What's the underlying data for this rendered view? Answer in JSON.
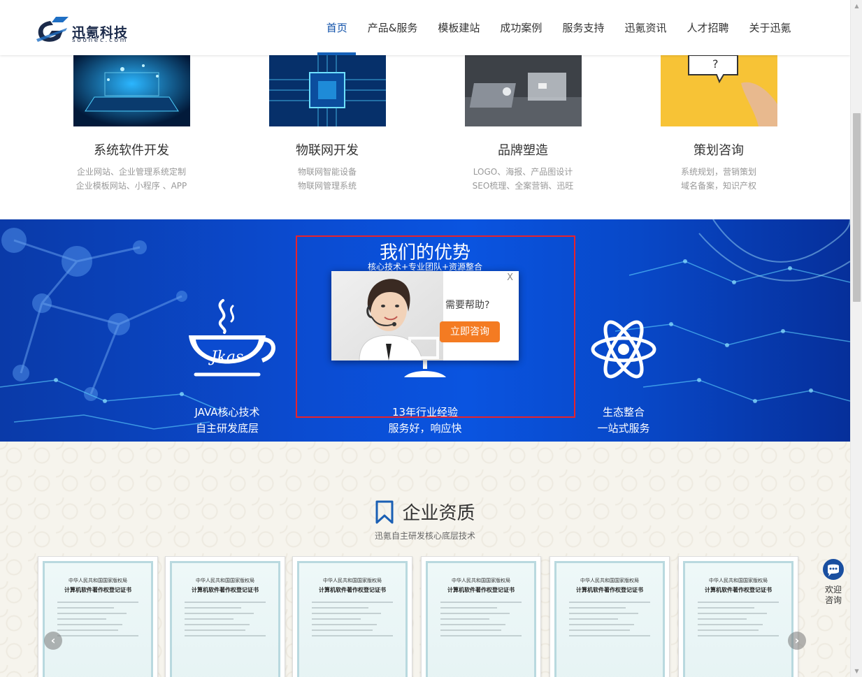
{
  "header": {
    "logo_name": "迅氪科技",
    "logo_sub": "soonec.com",
    "nav": [
      {
        "label": "首页",
        "active": true
      },
      {
        "label": "产品&服务"
      },
      {
        "label": "模板建站"
      },
      {
        "label": "成功案例"
      },
      {
        "label": "服务支持"
      },
      {
        "label": "迅氪资讯"
      },
      {
        "label": "人才招聘"
      },
      {
        "label": "关于迅氪"
      }
    ]
  },
  "services": [
    {
      "title": "系统软件开发",
      "desc1": "企业网站、企业管理系统定制",
      "desc2": "企业模板网站、小程序 、APP"
    },
    {
      "title": "物联网开发",
      "desc1": "物联网智能设备",
      "desc2": "物联网管理系统"
    },
    {
      "title": "品牌塑造",
      "desc1": "LOGO、海报、产品图设计",
      "desc2": "SEO梳理、全案营销、迅旺"
    },
    {
      "title": "策划咨询",
      "desc1": "系统规划，营销策划",
      "desc2": "域名备案，知识产权"
    }
  ],
  "advantages": {
    "title": "我们的优势",
    "subtitle": "核心技术+专业团队+资源整合",
    "items": [
      {
        "line1": "JAVA核心技术",
        "line2": "自主研发底层",
        "icon": "java-cup-icon",
        "icon_text": "Jkas"
      },
      {
        "line1": "13年行业经验",
        "line2": "服务好，响应快",
        "icon": "monitor-icon"
      },
      {
        "line1": "生态整合",
        "line2": "一站式服务",
        "icon": "atom-icon"
      }
    ]
  },
  "popup": {
    "close": "X",
    "help_text": "需要帮助?",
    "button": "立即咨询"
  },
  "qualification": {
    "title": "企业资质",
    "subtitle": "迅氪自主研发核心底层技术",
    "cert_line1": "中华人民共和国国家版权局",
    "cert_line2": "计算机软件著作权登记证书",
    "prev": "‹",
    "next": "›"
  },
  "consult": {
    "text": "欢迎咨询"
  },
  "colors": {
    "accent": "#0d4fa8",
    "banner": "#0b4bd0",
    "button": "#f47b22",
    "highlight": "#e8222b"
  }
}
